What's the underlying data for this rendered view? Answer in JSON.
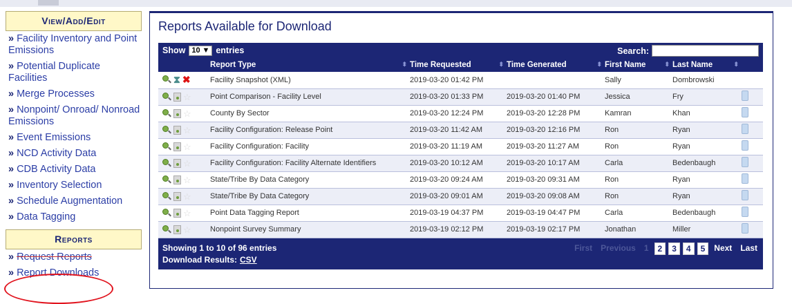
{
  "sidebar": {
    "view_heading": "View/Add/Edit",
    "items": [
      {
        "label": "Facility Inventory and Point Emissions"
      },
      {
        "label": "Potential Duplicate Facilities"
      },
      {
        "label": "Merge Processes"
      },
      {
        "label": "Nonpoint/ Onroad/ Nonroad Emissions"
      },
      {
        "label": "Event Emissions"
      },
      {
        "label": "NCD Activity Data"
      },
      {
        "label": "CDB Activity Data"
      },
      {
        "label": "Inventory Selection"
      },
      {
        "label": "Schedule Augmentation"
      },
      {
        "label": "Data Tagging"
      }
    ],
    "reports_heading": "Reports",
    "report_items": [
      {
        "label": "Request Reports"
      },
      {
        "label": "Report Downloads"
      }
    ],
    "bullet": "»"
  },
  "main": {
    "title": "Reports Available for Download",
    "show_label": "Show",
    "show_value": "10",
    "entries_label": "entries",
    "search_label": "Search:",
    "columns": [
      "Report Type",
      "Time Requested",
      "Time Generated",
      "First Name",
      "Last Name"
    ],
    "rows": [
      {
        "type": "Facility Snapshot (XML)",
        "requested": "2019-03-20 01:42 PM",
        "generated": "",
        "first": "Sally",
        "last": "Dombrowski",
        "status": "pending"
      },
      {
        "type": "Point Comparison - Facility Level",
        "requested": "2019-03-20 01:33 PM",
        "generated": "2019-03-20 01:40 PM",
        "first": "Jessica",
        "last": "Fry",
        "status": "done"
      },
      {
        "type": "County By Sector",
        "requested": "2019-03-20 12:24 PM",
        "generated": "2019-03-20 12:28 PM",
        "first": "Kamran",
        "last": "Khan",
        "status": "done"
      },
      {
        "type": "Facility Configuration: Release Point",
        "requested": "2019-03-20 11:42 AM",
        "generated": "2019-03-20 12:16 PM",
        "first": "Ron",
        "last": "Ryan",
        "status": "done"
      },
      {
        "type": "Facility Configuration: Facility",
        "requested": "2019-03-20 11:19 AM",
        "generated": "2019-03-20 11:27 AM",
        "first": "Ron",
        "last": "Ryan",
        "status": "done"
      },
      {
        "type": "Facility Configuration: Facility Alternate Identifiers",
        "requested": "2019-03-20 10:12 AM",
        "generated": "2019-03-20 10:17 AM",
        "first": "Carla",
        "last": "Bedenbaugh",
        "status": "done"
      },
      {
        "type": "State/Tribe By Data Category",
        "requested": "2019-03-20 09:24 AM",
        "generated": "2019-03-20 09:31 AM",
        "first": "Ron",
        "last": "Ryan",
        "status": "done"
      },
      {
        "type": "State/Tribe By Data Category",
        "requested": "2019-03-20 09:01 AM",
        "generated": "2019-03-20 09:08 AM",
        "first": "Ron",
        "last": "Ryan",
        "status": "done"
      },
      {
        "type": "Point Data Tagging Report",
        "requested": "2019-03-19 04:37 PM",
        "generated": "2019-03-19 04:47 PM",
        "first": "Carla",
        "last": "Bedenbaugh",
        "status": "done"
      },
      {
        "type": "Nonpoint Survey Summary",
        "requested": "2019-03-19 02:12 PM",
        "generated": "2019-03-19 02:17 PM",
        "first": "Jonathan",
        "last": "Miller",
        "status": "done"
      }
    ],
    "info": "Showing 1 to 10 of 96 entries",
    "download_label": "Download Results:",
    "download_csv": "CSV",
    "pager": {
      "first": "First",
      "previous": "Previous",
      "current": "1",
      "pages": [
        "2",
        "3",
        "4",
        "5"
      ],
      "next": "Next",
      "last": "Last"
    }
  },
  "colors": {
    "navy": "#1c2675",
    "heading_bg": "#fff8c8",
    "link": "#2c3ea6",
    "annotation": "#e1141e"
  }
}
